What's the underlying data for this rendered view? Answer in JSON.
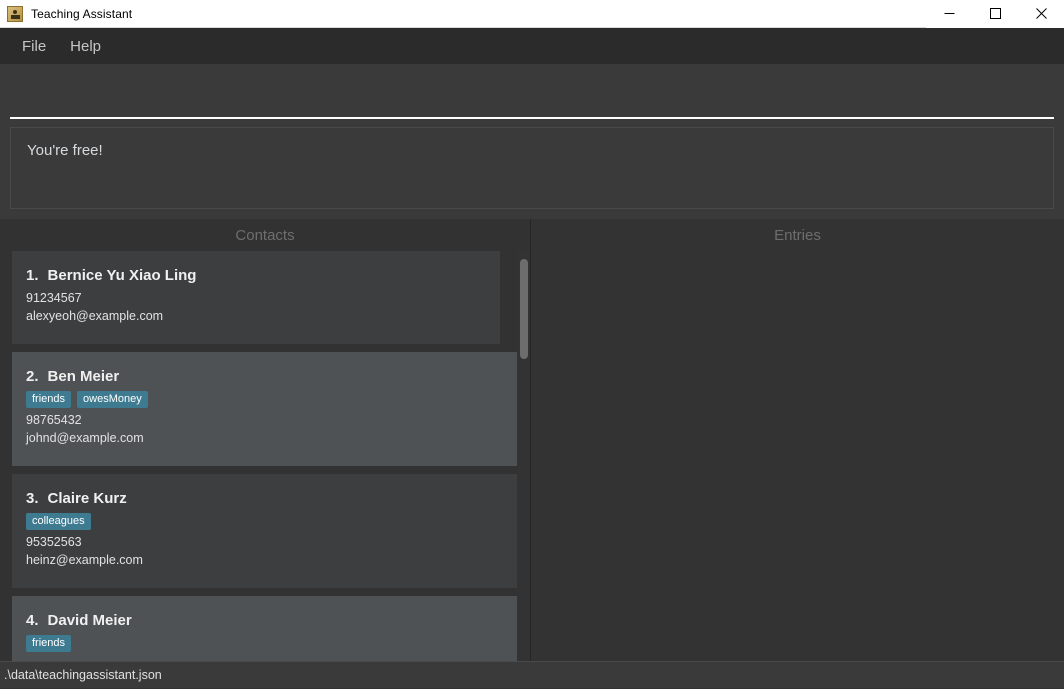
{
  "window": {
    "title": "Teaching Assistant",
    "icon": "app-person-icon",
    "controls": {
      "minimize": "minimize-icon",
      "maximize": "maximize-icon",
      "close": "close-icon"
    }
  },
  "menubar": {
    "items": [
      {
        "label": "File"
      },
      {
        "label": "Help"
      }
    ]
  },
  "command": {
    "value": "",
    "placeholder": ""
  },
  "result": {
    "text": "You're free!"
  },
  "panels": {
    "contacts": {
      "header": "Contacts",
      "items": [
        {
          "index": "1.",
          "name": "Bernice Yu Xiao Ling",
          "tags": [],
          "phone": "91234567",
          "email": "alexyeoh@example.com"
        },
        {
          "index": "2.",
          "name": "Ben Meier",
          "tags": [
            "friends",
            "owesMoney"
          ],
          "phone": "98765432",
          "email": "johnd@example.com"
        },
        {
          "index": "3.",
          "name": "Claire Kurz",
          "tags": [
            "colleagues"
          ],
          "phone": "95352563",
          "email": "heinz@example.com"
        },
        {
          "index": "4.",
          "name": "David Meier",
          "tags": [
            "friends"
          ],
          "phone": "",
          "email": ""
        }
      ]
    },
    "entries": {
      "header": "Entries",
      "items": []
    }
  },
  "statusbar": {
    "path": ".\\data\\teachingassistant.json"
  },
  "colors": {
    "accent_tag": "#3e7b91",
    "window_bg": "#323232",
    "card_bg": "#3c3e40",
    "card_bg_alt": "#4e5254",
    "input_underline": "#ffffff"
  }
}
